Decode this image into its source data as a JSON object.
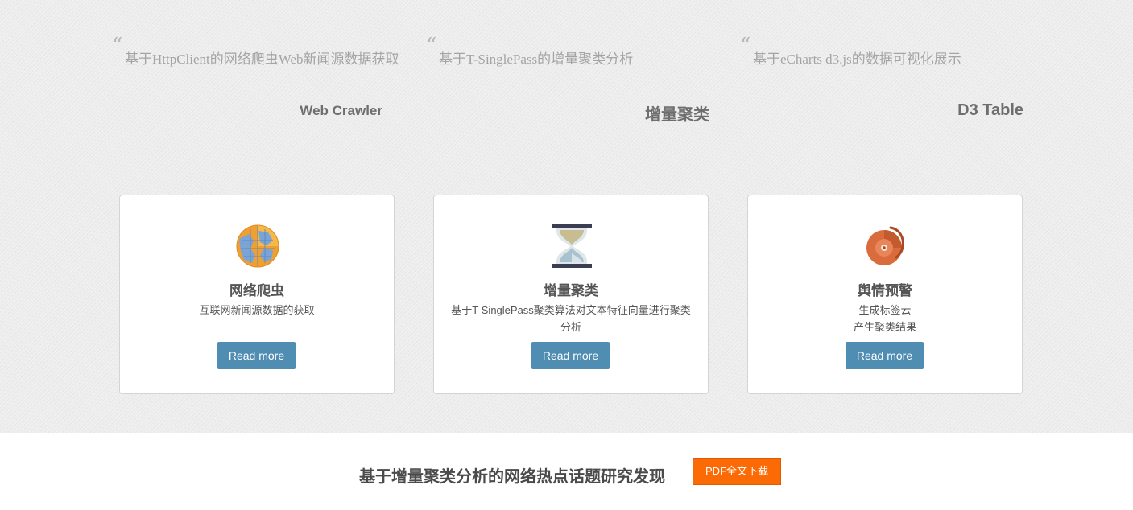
{
  "quotes": [
    {
      "mark": "“",
      "text": "基于HttpClient的网络爬虫Web新闻源数据获取",
      "author": "Web Crawler"
    },
    {
      "mark": "“",
      "text": "基于T-SinglePass的增量聚类分析",
      "author": "增量聚类"
    },
    {
      "mark": "“",
      "text": "基于eCharts  d3.js的数据可视化展示",
      "author": "D3 Table"
    }
  ],
  "cards": [
    {
      "icon": "globe-icon",
      "title": "网络爬虫",
      "desc": "互联网新闻源数据的获取",
      "button": "Read more"
    },
    {
      "icon": "hourglass-icon",
      "title": "增量聚类",
      "desc": "基于T-SinglePass聚类算法对文本特征向量进行聚类分析",
      "button": "Read more"
    },
    {
      "icon": "alarm-bell-icon",
      "title": "舆情预警",
      "desc_lines": [
        "生成标签云",
        "产生聚类结果"
      ],
      "button": "Read more"
    }
  ],
  "footer": {
    "headline": "基于增量聚类分析的网络热点话题研究发现",
    "download": "PDF全文下载"
  },
  "colors": {
    "button": "#4f8db3",
    "download": "#fc6a05",
    "background": "#ececec"
  }
}
